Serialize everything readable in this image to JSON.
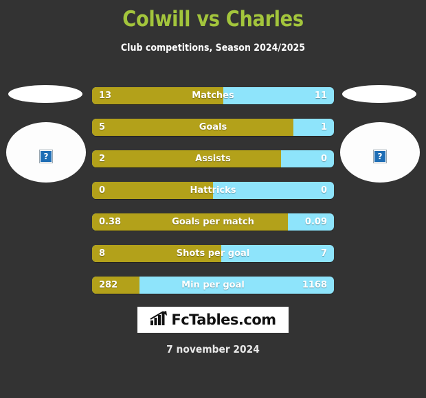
{
  "header": {
    "title": "Colwill vs Charles",
    "subtitle": "Club competitions, Season 2024/2025",
    "title_color": "#a3c53c"
  },
  "players": {
    "left": {
      "placeholder_glyph": "?",
      "alt_icon": "broken-image-icon"
    },
    "right": {
      "placeholder_glyph": "?",
      "alt_icon": "broken-image-icon"
    }
  },
  "colors": {
    "background": "#333333",
    "home_bar": "#b3a11a",
    "away_bar": "#8ee4fb",
    "text": "#ffffff"
  },
  "chart_data": {
    "type": "bar",
    "title": "Colwill vs Charles",
    "subtitle": "Club competitions, Season 2024/2025",
    "orientation": "horizontal-diverging",
    "series": [
      {
        "name": "Colwill",
        "color": "#b3a11a",
        "values": [
          13,
          5,
          2,
          0,
          0.38,
          8,
          282
        ]
      },
      {
        "name": "Charles",
        "color": "#8ee4fb",
        "values": [
          11,
          1,
          0,
          0,
          0.09,
          7,
          1168
        ]
      }
    ],
    "categories": [
      "Matches",
      "Goals",
      "Assists",
      "Hattricks",
      "Goals per match",
      "Shots per goal",
      "Min per goal"
    ],
    "xlabel": "",
    "ylabel": "",
    "grid": false,
    "legend": "none"
  },
  "stats": [
    {
      "label": "Matches",
      "home": "13",
      "away": "11",
      "home_pct": 54.2
    },
    {
      "label": "Goals",
      "home": "5",
      "away": "1",
      "home_pct": 83.3
    },
    {
      "label": "Assists",
      "home": "2",
      "away": "0",
      "home_pct": 78.0
    },
    {
      "label": "Hattricks",
      "home": "0",
      "away": "0",
      "home_pct": 50.0
    },
    {
      "label": "Goals per match",
      "home": "0.38",
      "away": "0.09",
      "home_pct": 80.9
    },
    {
      "label": "Shots per goal",
      "home": "8",
      "away": "7",
      "home_pct": 53.3
    },
    {
      "label": "Min per goal",
      "home": "282",
      "away": "1168",
      "home_pct": 19.5
    }
  ],
  "footer": {
    "logo_text": "FcTables.com",
    "logo_icon": "bar-chart-growth-icon",
    "date": "7 november 2024"
  }
}
